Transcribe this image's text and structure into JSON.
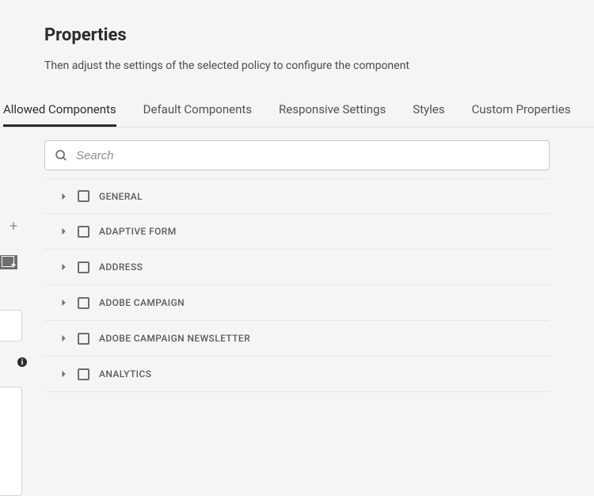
{
  "header": {
    "title": "Properties",
    "subtitle": "Then adjust the settings of the selected policy to configure the component"
  },
  "tabs": [
    {
      "label": "Allowed Components",
      "active": true
    },
    {
      "label": "Default Components",
      "active": false
    },
    {
      "label": "Responsive Settings",
      "active": false
    },
    {
      "label": "Styles",
      "active": false
    },
    {
      "label": "Custom Properties",
      "active": false
    }
  ],
  "search": {
    "placeholder": "Search"
  },
  "groups": [
    {
      "label": "GENERAL"
    },
    {
      "label": "ADAPTIVE FORM"
    },
    {
      "label": "ADDRESS"
    },
    {
      "label": "ADOBE CAMPAIGN"
    },
    {
      "label": "ADOBE CAMPAIGN NEWSLETTER"
    },
    {
      "label": "ANALYTICS"
    }
  ]
}
